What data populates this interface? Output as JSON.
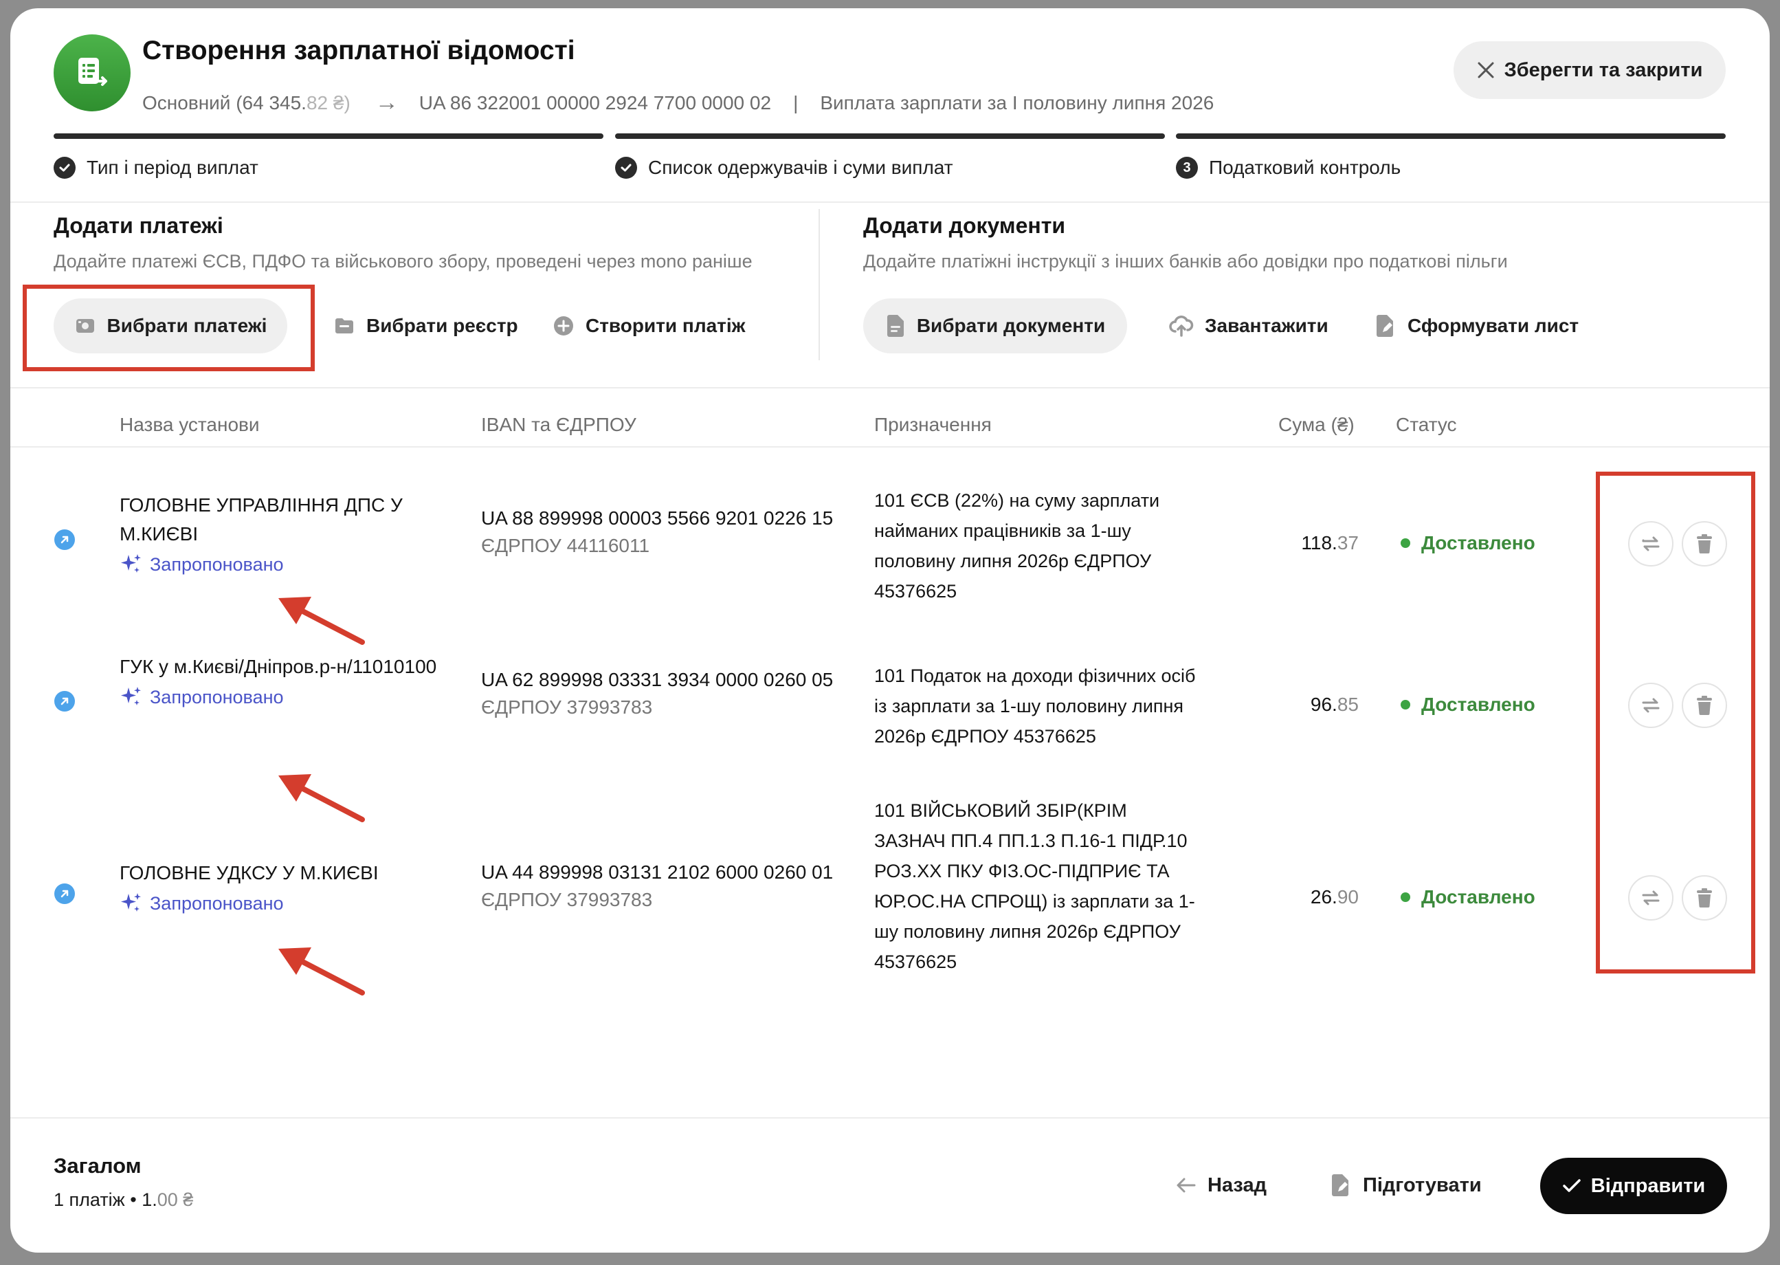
{
  "header": {
    "title": "Створення зарплатної відомості",
    "account_name": "Основний (64 345.",
    "account_cents": "82 ₴)",
    "iban": "UA 86 322001 00000 2924 7700 0000 02",
    "separator": "|",
    "payment_desc": "Виплата зарплати за І половину липня 2026",
    "close_label": "Зберегти та закрити"
  },
  "steps": [
    {
      "label": "Тип і період виплат",
      "state": "done"
    },
    {
      "label": "Список одержувачів і суми виплат",
      "state": "done"
    },
    {
      "label": "Податковий контроль",
      "state": "current",
      "number": "3"
    }
  ],
  "payments_section": {
    "title": "Додати платежі",
    "description": "Додайте платежі ЄСВ, ПДФО та військового збору, проведені через mono раніше",
    "select_payments": "Вибрати платежі",
    "select_registry": "Вибрати реєстр",
    "create_payment": "Створити платіж"
  },
  "documents_section": {
    "title": "Додати документи",
    "description": "Додайте платіжні інструкції з інших банків або довідки про податкові пільги",
    "select_documents": "Вибрати документи",
    "upload": "Завантажити",
    "generate_letter": "Сформувати лист"
  },
  "table": {
    "columns": [
      "Назва установи",
      "IBAN та ЄДРПОУ",
      "Призначення",
      "Сума (₴)",
      "Статус"
    ],
    "rows": [
      {
        "institution": "ГОЛОВНЕ УПРАВЛІННЯ ДПС У М.КИЄВІ",
        "suggested": "Запропоновано",
        "iban": "UA 88 899998 00003 5566 9201 0226 15",
        "edrpou": "ЄДРПОУ 44116011",
        "purpose": "101 ЄСВ (22%) на суму зарплати найманих працівників за 1-шу половину липня 2026р ЄДРПОУ 45376625",
        "amount_int": "118.",
        "amount_dec": "37",
        "status": "Доставлено"
      },
      {
        "institution": "ГУК у м.Києві/Дніпров.р-н/11010100",
        "suggested": "Запропоновано",
        "iban": "UA 62 899998 03331 3934 0000 0260 05",
        "edrpou": "ЄДРПОУ 37993783",
        "purpose": "101 Податок на доходи фізичних осіб із зарплати за 1-шу половину липня 2026р ЄДРПОУ 45376625",
        "amount_int": "96.",
        "amount_dec": "85",
        "status": "Доставлено"
      },
      {
        "institution": "ГОЛОВНЕ УДКСУ У М.КИЄВІ",
        "suggested": "Запропоновано",
        "iban": "UA 44 899998 03131 2102 6000 0260 01",
        "edrpou": "ЄДРПОУ 37993783",
        "purpose": "101 ВІЙСЬКОВИЙ ЗБІР(КРІМ ЗАЗНАЧ ПП.4 ПП.1.3 П.16-1 ПІДР.10 РОЗ.ХХ ПКУ ФІЗ.ОС-ПІДПРИЄ ТА ЮР.ОС.НА СПРОЩ) із зарплати за 1-шу половину липня 2026р ЄДРПОУ 45376625",
        "amount_int": "26.",
        "amount_dec": "90",
        "status": "Доставлено"
      }
    ]
  },
  "footer": {
    "total_title": "Загалом",
    "total_count": "1 платіж",
    "bullet": "•",
    "total_int": "1.",
    "total_dec": "00 ₴",
    "back": "Назад",
    "prepare": "Підготувати",
    "send": "Відправити"
  },
  "colors": {
    "accent_green": "#3da443",
    "suggested_violet": "#4a54c8",
    "annotation_red": "#d43d2d",
    "primary_button": "#0b0b0b"
  }
}
